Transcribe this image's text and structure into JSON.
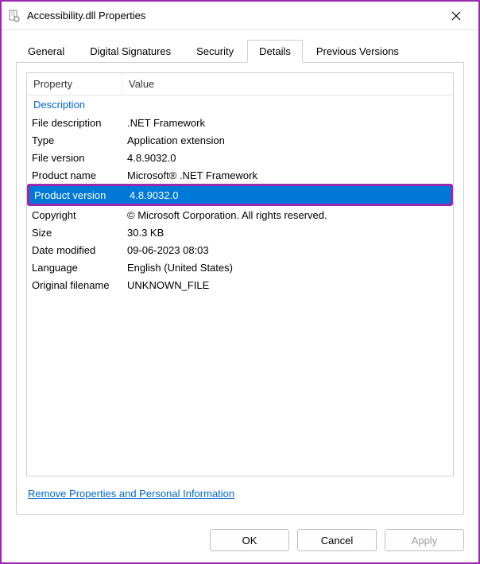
{
  "window": {
    "title": "Accessibility.dll Properties"
  },
  "tabs": {
    "general": "General",
    "digital_signatures": "Digital Signatures",
    "security": "Security",
    "details": "Details",
    "previous_versions": "Previous Versions"
  },
  "columns": {
    "property": "Property",
    "value": "Value"
  },
  "section": {
    "description": "Description"
  },
  "rows": {
    "file_description": {
      "label": "File description",
      "value": ".NET Framework"
    },
    "type": {
      "label": "Type",
      "value": "Application extension"
    },
    "file_version": {
      "label": "File version",
      "value": "4.8.9032.0"
    },
    "product_name": {
      "label": "Product name",
      "value": "Microsoft® .NET Framework"
    },
    "product_version": {
      "label": "Product version",
      "value": "4.8.9032.0"
    },
    "copyright": {
      "label": "Copyright",
      "value": "© Microsoft Corporation.  All rights reserved."
    },
    "size": {
      "label": "Size",
      "value": "30.3 KB"
    },
    "date_modified": {
      "label": "Date modified",
      "value": "09-06-2023 08:03"
    },
    "language": {
      "label": "Language",
      "value": "English (United States)"
    },
    "original_filename": {
      "label": "Original filename",
      "value": "UNKNOWN_FILE"
    }
  },
  "link": {
    "remove_properties": "Remove Properties and Personal Information"
  },
  "buttons": {
    "ok": "OK",
    "cancel": "Cancel",
    "apply": "Apply"
  }
}
